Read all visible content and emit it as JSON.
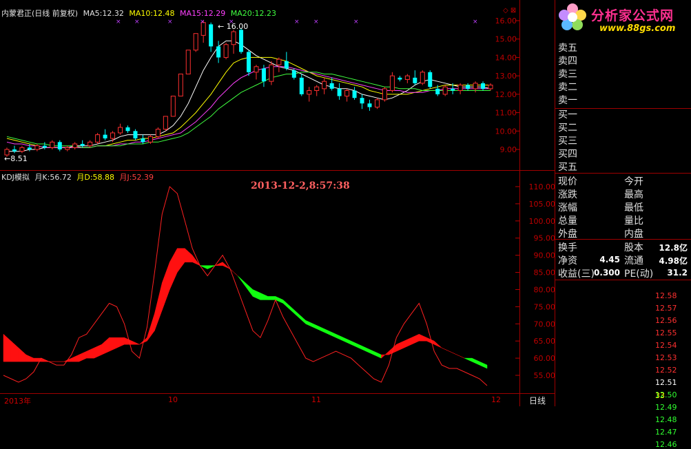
{
  "header": {
    "stock": "内蒙君正(日线 前复权)",
    "ma5_label": "MA5:",
    "ma5": "12.32",
    "ma10_label": "MA10:",
    "ma10": "12.48",
    "ma15_label": "MA15:",
    "ma15": "12.29",
    "ma20_label": "MA20:",
    "ma20": "12.23"
  },
  "kdj": {
    "title": "KDJ模拟",
    "k_label": "月K:",
    "k": "56.72",
    "d_label": "月D:",
    "d": "58.88",
    "j_label": "月J:",
    "j": "52.39",
    "timestamp": "2013-12-2,8:57:38"
  },
  "logo": {
    "name": "分析家公式网",
    "url": "www.88gs.com"
  },
  "orderbook": {
    "sell": [
      "卖五",
      "卖四",
      "卖三",
      "卖二",
      "卖一"
    ],
    "buy": [
      "买一",
      "买二",
      "买三",
      "买四",
      "买五"
    ]
  },
  "quote_labels": [
    [
      "现价",
      "今开"
    ],
    [
      "涨跌",
      "最高"
    ],
    [
      "涨幅",
      "最低"
    ],
    [
      "总量",
      "量比"
    ],
    [
      "外盘",
      "内盘"
    ]
  ],
  "stats": [
    {
      "l1": "换手",
      "v1": "",
      "l2": "股本",
      "v2": "12.8亿"
    },
    {
      "l1": "净资",
      "v1": "4.45",
      "l2": "流通",
      "v2": "4.98亿"
    },
    {
      "l1": "收益(三)",
      "v1": "0.300",
      "l2": "PE(动)",
      "v2": "31.2"
    }
  ],
  "price_ticks": [
    "12.58",
    "12.57",
    "12.56",
    "12.55",
    "12.54",
    "12.53",
    "12.52",
    "12.51",
    "12.50",
    "12.49",
    "12.48",
    "12.47",
    "12.46"
  ],
  "price_tick_colors": [
    "#ff3030",
    "#ff3030",
    "#ff3030",
    "#ff3030",
    "#ff3030",
    "#ff3030",
    "#ff3030",
    "#ffffff",
    "#30ff30",
    "#30ff30",
    "#30ff30",
    "#30ff30",
    "#30ff30"
  ],
  "bottom_tick": "33",
  "xaxis": {
    "labels": [
      "2013年",
      "10",
      "11",
      "12"
    ],
    "period": "日线"
  },
  "chart_data": [
    {
      "type": "candlestick",
      "title": "内蒙君正(日线 前复权)",
      "ylim": [
        8.4,
        16.4
      ],
      "yticks": [
        "16.00",
        "15.00",
        "14.00",
        "13.00",
        "12.00",
        "11.00",
        "10.00",
        "9.00"
      ],
      "annotations": {
        "high": "16.00",
        "low": "8.51"
      },
      "ohlc": [
        [
          8.7,
          9.1,
          8.6,
          9.0
        ],
        [
          9.0,
          9.2,
          8.8,
          8.9
        ],
        [
          8.9,
          9.2,
          8.8,
          9.1
        ],
        [
          9.1,
          9.3,
          8.9,
          9.0
        ],
        [
          9.0,
          9.3,
          8.9,
          9.2
        ],
        [
          9.2,
          9.4,
          9.0,
          9.1
        ],
        [
          9.1,
          9.5,
          9.0,
          9.4
        ],
        [
          9.4,
          9.5,
          8.9,
          9.0
        ],
        [
          9.0,
          9.2,
          8.9,
          9.1
        ],
        [
          9.1,
          9.4,
          9.0,
          9.3
        ],
        [
          9.3,
          9.5,
          9.1,
          9.2
        ],
        [
          9.2,
          9.5,
          9.1,
          9.4
        ],
        [
          9.4,
          9.9,
          9.3,
          9.8
        ],
        [
          9.8,
          10.1,
          9.5,
          9.6
        ],
        [
          9.6,
          10.0,
          9.4,
          9.9
        ],
        [
          9.9,
          10.4,
          9.8,
          10.2
        ],
        [
          10.2,
          10.3,
          9.9,
          10.0
        ],
        [
          10.0,
          10.1,
          9.5,
          9.6
        ],
        [
          9.6,
          9.8,
          9.3,
          9.4
        ],
        [
          9.4,
          9.8,
          9.3,
          9.7
        ],
        [
          9.7,
          10.2,
          9.6,
          10.1
        ],
        [
          10.1,
          10.8,
          10.0,
          10.8
        ],
        [
          10.8,
          11.9,
          10.8,
          11.9
        ],
        [
          11.9,
          13.1,
          11.9,
          13.1
        ],
        [
          13.1,
          14.4,
          13.1,
          14.4
        ],
        [
          14.4,
          15.3,
          14.3,
          15.3
        ],
        [
          15.2,
          16.0,
          14.8,
          15.9
        ],
        [
          15.8,
          15.9,
          14.3,
          14.6
        ],
        [
          14.6,
          14.9,
          13.7,
          14.0
        ],
        [
          14.0,
          14.8,
          13.9,
          14.7
        ],
        [
          14.7,
          15.5,
          14.2,
          15.4
        ],
        [
          15.5,
          15.6,
          14.2,
          14.3
        ],
        [
          14.3,
          14.4,
          13.0,
          13.2
        ],
        [
          13.2,
          13.6,
          12.8,
          13.5
        ],
        [
          13.4,
          13.6,
          12.4,
          12.7
        ],
        [
          12.7,
          13.8,
          12.5,
          13.6
        ],
        [
          13.6,
          14.0,
          13.2,
          13.9
        ],
        [
          13.8,
          14.3,
          13.3,
          13.4
        ],
        [
          13.3,
          13.4,
          12.8,
          12.9
        ],
        [
          12.9,
          13.1,
          11.9,
          12.0
        ],
        [
          12.0,
          12.4,
          11.6,
          12.2
        ],
        [
          12.2,
          12.5,
          11.9,
          12.4
        ],
        [
          12.3,
          12.9,
          12.0,
          12.7
        ],
        [
          12.6,
          12.9,
          12.2,
          12.3
        ],
        [
          12.3,
          12.6,
          11.7,
          11.9
        ],
        [
          11.9,
          12.3,
          11.6,
          12.2
        ],
        [
          12.2,
          12.4,
          11.7,
          11.8
        ],
        [
          11.8,
          12.0,
          11.2,
          11.5
        ],
        [
          11.5,
          11.7,
          11.1,
          11.3
        ],
        [
          11.3,
          11.8,
          11.2,
          11.7
        ],
        [
          11.7,
          12.4,
          11.6,
          12.3
        ],
        [
          12.2,
          13.2,
          12.1,
          13.0
        ],
        [
          12.9,
          13.0,
          12.7,
          12.8
        ],
        [
          12.8,
          13.1,
          12.6,
          13.0
        ],
        [
          12.9,
          13.3,
          12.5,
          12.6
        ],
        [
          12.6,
          13.3,
          12.5,
          13.2
        ],
        [
          13.2,
          13.3,
          12.3,
          12.4
        ],
        [
          12.3,
          12.5,
          11.9,
          12.0
        ],
        [
          12.0,
          12.5,
          11.9,
          12.4
        ],
        [
          12.3,
          12.6,
          12.0,
          12.2
        ],
        [
          12.2,
          12.6,
          12.0,
          12.5
        ],
        [
          12.5,
          12.6,
          12.2,
          12.3
        ],
        [
          12.3,
          12.7,
          12.1,
          12.6
        ],
        [
          12.6,
          12.7,
          12.2,
          12.3
        ],
        [
          12.3,
          12.6,
          12.2,
          12.5
        ]
      ],
      "series": [
        {
          "name": "MA5",
          "values": [
            8.9,
            8.9,
            8.9,
            9.0,
            9.0,
            9.1,
            9.1,
            9.1,
            9.1,
            9.2,
            9.2,
            9.2,
            9.3,
            9.4,
            9.5,
            9.7,
            9.8,
            9.8,
            9.8,
            9.8,
            9.8,
            10.0,
            10.3,
            10.8,
            11.5,
            12.4,
            13.3,
            14.0,
            14.6,
            14.9,
            14.9,
            14.7,
            14.4,
            14.1,
            13.9,
            13.7,
            13.5,
            13.4,
            13.3,
            13.1,
            12.9,
            12.7,
            12.5,
            12.4,
            12.3,
            12.3,
            12.2,
            12.0,
            11.9,
            11.8,
            11.7,
            11.8,
            12.0,
            12.2,
            12.5,
            12.7,
            12.8,
            12.7,
            12.6,
            12.5,
            12.4,
            12.4,
            12.4,
            12.4,
            12.3
          ]
        },
        {
          "name": "MA10",
          "values": [
            9.6,
            9.5,
            9.4,
            9.3,
            9.2,
            9.1,
            9.1,
            9.1,
            9.1,
            9.1,
            9.1,
            9.1,
            9.2,
            9.2,
            9.3,
            9.4,
            9.5,
            9.5,
            9.6,
            9.6,
            9.7,
            9.8,
            9.9,
            10.2,
            10.6,
            11.0,
            11.5,
            12.0,
            12.6,
            13.2,
            13.7,
            13.9,
            14.0,
            14.0,
            14.0,
            14.0,
            13.9,
            13.8,
            13.6,
            13.4,
            13.2,
            13.0,
            12.9,
            12.8,
            12.7,
            12.6,
            12.5,
            12.4,
            12.2,
            12.1,
            12.0,
            12.0,
            12.0,
            12.0,
            12.1,
            12.2,
            12.3,
            12.4,
            12.5,
            12.5,
            12.5,
            12.5,
            12.5,
            12.5,
            12.5
          ]
        },
        {
          "name": "MA15",
          "values": [
            9.4,
            9.3,
            9.3,
            9.2,
            9.2,
            9.1,
            9.1,
            9.1,
            9.1,
            9.1,
            9.1,
            9.1,
            9.2,
            9.2,
            9.2,
            9.3,
            9.3,
            9.4,
            9.4,
            9.5,
            9.6,
            9.7,
            9.8,
            9.9,
            10.2,
            10.5,
            10.9,
            11.3,
            11.8,
            12.2,
            12.6,
            12.9,
            13.1,
            13.3,
            13.4,
            13.5,
            13.5,
            13.5,
            13.4,
            13.3,
            13.2,
            13.1,
            13.0,
            12.9,
            12.8,
            12.7,
            12.6,
            12.5,
            12.4,
            12.3,
            12.2,
            12.2,
            12.2,
            12.1,
            12.1,
            12.1,
            12.2,
            12.2,
            12.3,
            12.3,
            12.3,
            12.3,
            12.3,
            12.3,
            12.3
          ]
        },
        {
          "name": "MA20",
          "values": [
            9.7,
            9.6,
            9.5,
            9.4,
            9.3,
            9.3,
            9.2,
            9.2,
            9.2,
            9.2,
            9.1,
            9.1,
            9.2,
            9.2,
            9.2,
            9.2,
            9.3,
            9.3,
            9.3,
            9.4,
            9.4,
            9.5,
            9.6,
            9.7,
            9.9,
            10.2,
            10.5,
            10.8,
            11.2,
            11.5,
            11.8,
            12.1,
            12.3,
            12.5,
            12.7,
            12.9,
            13.0,
            13.1,
            13.1,
            13.2,
            13.2,
            13.2,
            13.1,
            13.1,
            13.0,
            12.9,
            12.8,
            12.7,
            12.6,
            12.5,
            12.4,
            12.4,
            12.3,
            12.3,
            12.3,
            12.2,
            12.2,
            12.2,
            12.2,
            12.2,
            12.2,
            12.2,
            12.2,
            12.2,
            12.2
          ]
        }
      ]
    },
    {
      "type": "area",
      "title": "KDJ模拟",
      "ylim": [
        52,
        113
      ],
      "yticks": [
        "110.00",
        "105.00",
        "100.00",
        "95.00",
        "90.00",
        "85.00",
        "80.00",
        "75.00",
        "70.00",
        "65.00",
        "60.00",
        "55.00"
      ],
      "series": [
        {
          "name": "月K",
          "values": [
            67,
            65,
            63,
            61,
            60,
            60,
            59,
            59,
            59,
            60,
            61,
            62,
            63,
            64,
            66,
            66,
            66,
            65,
            64,
            66,
            73,
            82,
            88,
            92,
            92,
            90,
            87,
            86,
            87,
            88,
            86,
            84,
            81,
            78,
            77,
            77,
            77,
            76,
            74,
            72,
            70,
            69,
            68,
            67,
            66,
            65,
            64,
            63,
            62,
            61,
            60,
            62,
            64,
            65,
            66,
            67,
            66,
            65,
            63,
            62,
            61,
            60,
            59,
            58,
            57
          ]
        },
        {
          "name": "月D",
          "values": [
            59,
            59,
            59,
            59,
            59,
            59,
            59,
            59,
            59,
            59,
            59,
            60,
            60,
            61,
            62,
            63,
            64,
            64,
            64,
            65,
            68,
            74,
            80,
            85,
            88,
            88,
            87,
            87,
            87,
            87,
            86,
            84,
            82,
            80,
            79,
            78,
            78,
            77,
            75,
            73,
            71,
            70,
            69,
            68,
            67,
            66,
            65,
            64,
            63,
            62,
            61,
            61,
            62,
            63,
            64,
            65,
            65,
            64,
            63,
            62,
            61,
            60,
            60,
            59,
            58
          ]
        },
        {
          "name": "月J",
          "values": [
            55,
            54,
            53,
            54,
            56,
            60,
            59,
            58,
            58,
            61,
            66,
            67,
            70,
            73,
            76,
            75,
            70,
            62,
            60,
            69,
            85,
            102,
            110,
            108,
            100,
            92,
            87,
            84,
            87,
            90,
            86,
            80,
            74,
            68,
            66,
            71,
            77,
            72,
            68,
            64,
            60,
            59,
            60,
            61,
            62,
            61,
            60,
            58,
            56,
            54,
            53,
            58,
            66,
            70,
            73,
            76,
            70,
            62,
            58,
            57,
            57,
            56,
            55,
            54,
            52
          ]
        }
      ]
    }
  ]
}
